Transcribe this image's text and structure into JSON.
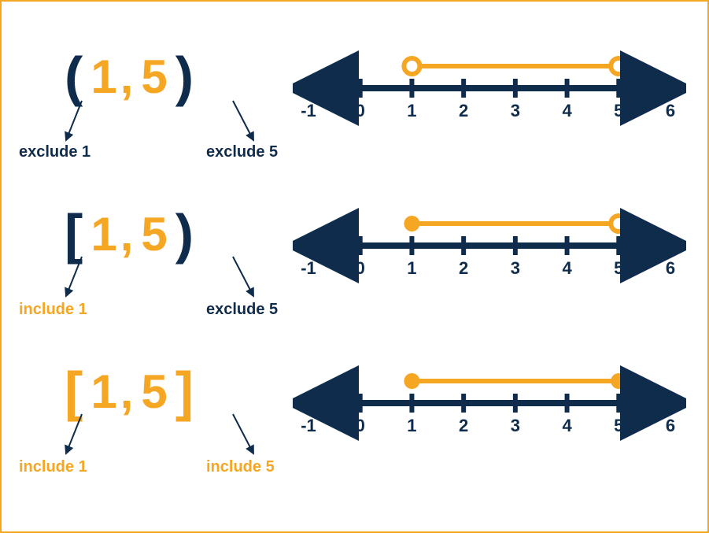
{
  "type": "interval-notation-diagram",
  "colors": {
    "navy": "#0f2c4c",
    "gold": "#f5a623"
  },
  "number_line": {
    "min_tick": -1,
    "max_tick": 6,
    "tick_labels": [
      "-1",
      "0",
      "1",
      "2",
      "3",
      "4",
      "5",
      "6"
    ]
  },
  "rows": [
    {
      "interval_text": {
        "left_bracket": "(",
        "left_style": "navy",
        "a": "1",
        "b": "5",
        "right_bracket": ")",
        "right_style": "navy"
      },
      "left_anno": {
        "text": "exclude 1",
        "style": "navy"
      },
      "right_anno": {
        "text": "exclude 5",
        "style": "navy"
      },
      "segment": {
        "from_value": 1,
        "to_value": 5,
        "left_endpoint": "open",
        "right_endpoint": "open"
      }
    },
    {
      "interval_text": {
        "left_bracket": "[",
        "left_style": "navy",
        "a": "1",
        "b": "5",
        "right_bracket": ")",
        "right_style": "navy"
      },
      "left_anno": {
        "text": "include 1",
        "style": "gold"
      },
      "right_anno": {
        "text": "exclude 5",
        "style": "navy"
      },
      "segment": {
        "from_value": 1,
        "to_value": 5,
        "left_endpoint": "closed",
        "right_endpoint": "open"
      }
    },
    {
      "interval_text": {
        "left_bracket": "[",
        "left_style": "gold",
        "a": "1",
        "b": "5",
        "right_bracket": "]",
        "right_style": "gold"
      },
      "left_anno": {
        "text": "include 1",
        "style": "gold"
      },
      "right_anno": {
        "text": "include 5",
        "style": "gold"
      },
      "segment": {
        "from_value": 1,
        "to_value": 5,
        "left_endpoint": "closed",
        "right_endpoint": "closed"
      }
    }
  ],
  "chart_data": {
    "type": "number-line-intervals",
    "axis_range": [
      -1,
      6
    ],
    "ticks": [
      -1,
      0,
      1,
      2,
      3,
      4,
      5,
      6
    ],
    "intervals": [
      {
        "notation": "(1, 5)",
        "from": 1,
        "to": 5,
        "left_closed": false,
        "right_closed": false
      },
      {
        "notation": "[1, 5)",
        "from": 1,
        "to": 5,
        "left_closed": true,
        "right_closed": false
      },
      {
        "notation": "[1, 5]",
        "from": 1,
        "to": 5,
        "left_closed": true,
        "right_closed": true
      }
    ]
  }
}
